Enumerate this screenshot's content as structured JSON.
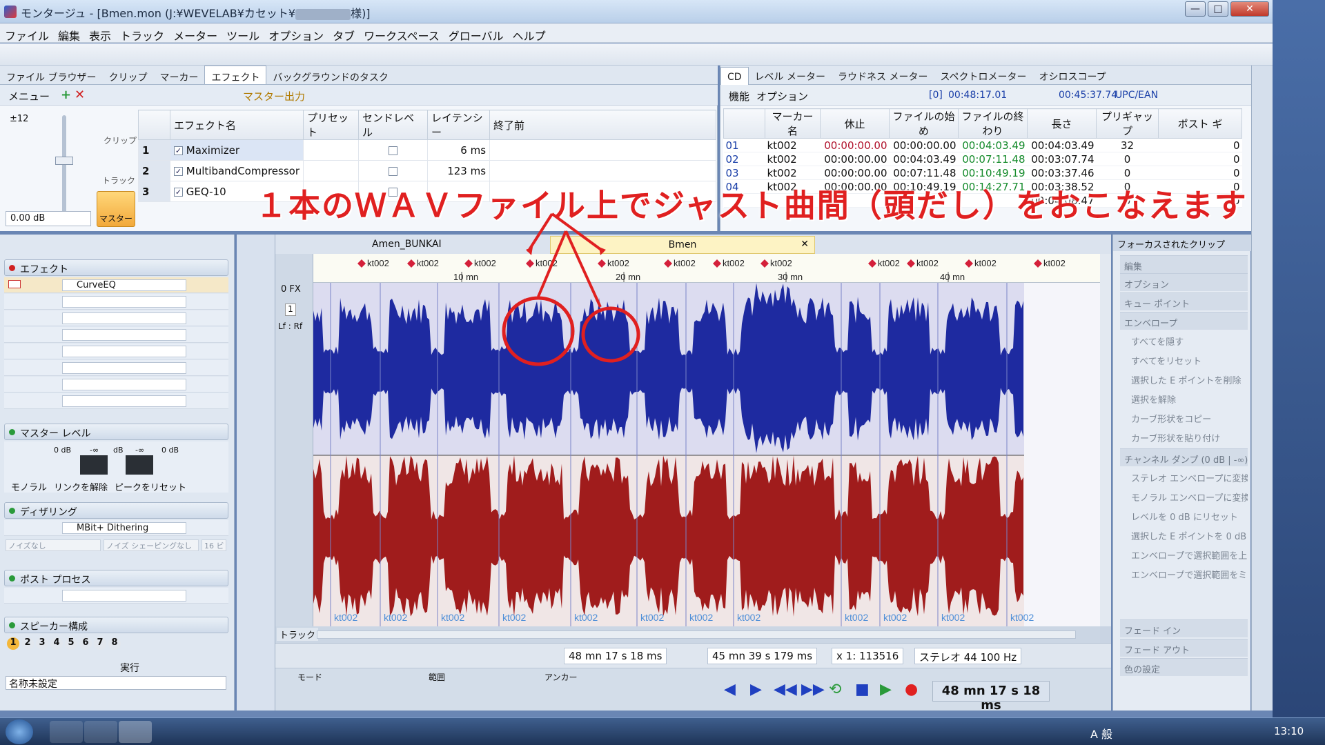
{
  "window": {
    "title": "モンタージュ - [Bmen.mon (J:¥WEVELAB¥カセット¥",
    "title_suffix": "様)]",
    "buttons": [
      "—",
      "□",
      "✕"
    ]
  },
  "menu": [
    "ファイル",
    "編集",
    "表示",
    "トラック",
    "メーター",
    "ツール",
    "オプション",
    "タブ",
    "ワークスペース",
    "グローバル",
    "ヘルプ"
  ],
  "tabs": [
    "ファイル ブラウザー",
    "クリップ",
    "マーカー",
    "エフェクト",
    "バックグラウンドのタスク"
  ],
  "effects": {
    "menu_label": "メニュー",
    "master_output_label": "マスター出力",
    "columns": [
      "エフェクト名",
      "プリセット",
      "センドレベル",
      "レイテンシー",
      "終了前"
    ],
    "rows": [
      {
        "num": "1",
        "name": "Maximizer",
        "latency": "6 ms"
      },
      {
        "num": "2",
        "name": "MultibandCompressor",
        "latency": "123 ms"
      },
      {
        "num": "3",
        "name": "GEQ-10",
        "latency": ""
      }
    ],
    "gain_label": "±12",
    "gain_value": "0.00 dB",
    "side_labels": [
      "クリップ",
      "トラック",
      "マスター"
    ]
  },
  "cd": {
    "tabs": [
      "CD",
      "レベル メーター",
      "ラウドネス メーター",
      "スペクトロメーター",
      "オシロスコープ"
    ],
    "toolbar": {
      "func": "機能",
      "option": "オプション",
      "marker_index": "[0]",
      "pos": "00:48:17.01",
      "total": "00:45:37.74",
      "upc": "UPC/EAN"
    },
    "columns": [
      "",
      "マーカー名",
      "休止",
      "ファイルの始め",
      "ファイルの終わり",
      "長さ",
      "プリギャップ",
      "ポスト ギ"
    ],
    "rows": [
      {
        "num": "01",
        "name": "kt002",
        "pause": "00:00:00.00",
        "start": "00:00:00.00",
        "end": "00:04:03.49",
        "length": "00:04:03.49",
        "pregap": "32",
        "post": "0"
      },
      {
        "num": "02",
        "name": "kt002",
        "pause": "00:00:00.00",
        "start": "00:04:03.49",
        "end": "00:07:11.48",
        "length": "00:03:07.74",
        "pregap": "0",
        "post": "0"
      },
      {
        "num": "03",
        "name": "kt002",
        "pause": "00:00:00.00",
        "start": "00:07:11.48",
        "end": "00:10:49.19",
        "length": "00:03:37.46",
        "pregap": "0",
        "post": "0"
      },
      {
        "num": "04",
        "name": "kt002",
        "pause": "00:00:00.00",
        "start": "00:10:49.19",
        "end": "00:14:27.71",
        "length": "00:03:38.52",
        "pregap": "0",
        "post": "0"
      },
      {
        "num": "",
        "name": "",
        "pause": "",
        "start": "",
        "end": "",
        "length": "00:04:08.47",
        "pregap": "0",
        "post": "0"
      }
    ]
  },
  "left": {
    "effect_section": "エフェクト",
    "slot1": "CurveEQ",
    "master_level": "マスター レベル",
    "meter_labels": [
      "0 dB",
      "-∞",
      "dB",
      "-∞",
      "0 dB"
    ],
    "meter_buttons": [
      "モノラル",
      "リンクを解除",
      "ピークをリセット"
    ],
    "dithering": "ディザリング",
    "dither_plugin": "MBit+ Dithering",
    "dither_opts": [
      "ノイズなし",
      "ノイズ シェーピングなし",
      "16 ビ"
    ],
    "post_process": "ポスト プロセス",
    "speaker": "スピーカー構成",
    "speaker_nums": [
      "1",
      "2",
      "3",
      "4",
      "5",
      "6",
      "7",
      "8"
    ],
    "run": "実行",
    "preset_name": "名称未設定"
  },
  "editor": {
    "tabs": [
      "Amen_BUNKAI",
      "Bmen"
    ],
    "marker_label": "kt002",
    "ruler_labels": [
      "10 mn",
      "20 mn",
      "30 mn",
      "40 mn"
    ],
    "fx_label": "0 FX",
    "lr_label": "Lf : Rf",
    "track_num": "1",
    "track_label": "トラック",
    "status": [
      "48 mn 17 s 18 ms",
      "45 mn 39 s 179 ms",
      "x 1: 113516",
      "ステレオ 44 100 Hz"
    ],
    "transport_labels": [
      "モード",
      "範囲",
      "アンカー"
    ],
    "time_display": "48 mn 17 s 18 ms",
    "wave_colors": {
      "top": "#1e2aa0",
      "bottom": "#a01c1c",
      "marker": "#d4203a"
    }
  },
  "focus": {
    "title": "フォーカスされたクリップ",
    "items": [
      "編集",
      "オプション",
      "キュー ポイント",
      "エンベロープ",
      "すべてを隠す",
      "すべてをリセット",
      "選択した E ポイントを削除",
      "選択を解除",
      "カーブ形状をコピー",
      "カーブ形状を貼り付け",
      "チャンネル ダンプ (0 dB | -∞)",
      "ステレオ エンベロープに変換",
      "モノラル エンベロープに変換",
      "レベルを 0 dB にリセット",
      "選択した E ポイントを 0 dB",
      "エンベロープで選択範囲を上",
      "エンベロープで選択範囲をミ",
      "フェード イン",
      "フェード アウト",
      "色の設定"
    ]
  },
  "annotation": "１本のＷＡＶファイル上でジャスト曲間（頭だし）をおこなえます",
  "taskbar": {
    "ime": "A 般",
    "time": "13:10"
  }
}
